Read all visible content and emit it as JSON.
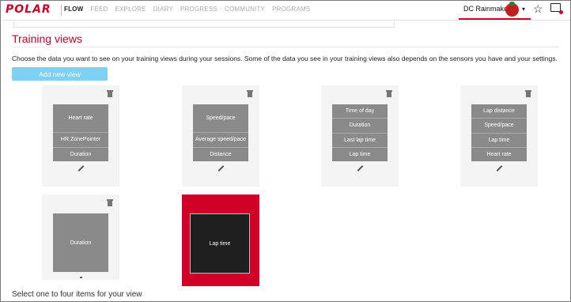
{
  "nav": {
    "logo": "POLAR",
    "links": [
      {
        "label": "FLOW",
        "active": true
      },
      {
        "label": "FEED",
        "active": false
      },
      {
        "label": "EXPLORE",
        "active": false
      },
      {
        "label": "DIARY",
        "active": false
      },
      {
        "label": "PROGRESS",
        "active": false
      },
      {
        "label": "COMMUNITY",
        "active": false
      },
      {
        "label": "PROGRAMS",
        "active": false
      }
    ],
    "user_name": "DC Rainmaker",
    "caret": "▾",
    "star": "☆"
  },
  "page": {
    "title": "Training views",
    "description": "Choose the data you want to see on your training views during your sessions. Some of the data you see in your training views also depends on the sensors you have and your settings.",
    "add_button": "Add new view",
    "footer": "Select one to four items for your view"
  },
  "views": [
    {
      "fields": [
        "Heart rate",
        "HR ZonePointer",
        "Duration"
      ],
      "selected": false
    },
    {
      "fields": [
        "Speed/pace",
        "Average speed/pace",
        "Distance"
      ],
      "selected": false
    },
    {
      "fields": [
        "Time of day",
        "Duration",
        "Last lap time",
        "Lap time"
      ],
      "selected": false
    },
    {
      "fields": [
        "Lap distance",
        "Speed/pace",
        "Lap time",
        "Heart rate"
      ],
      "selected": false
    },
    {
      "fields": [
        "Duration"
      ],
      "selected": false
    },
    {
      "fields": [
        "Lap time"
      ],
      "selected": true
    }
  ],
  "colors": {
    "brand": "#d10027",
    "button": "#7fd1f3",
    "screen": "#8a8a8a",
    "selected_screen": "#1f1f1f"
  }
}
